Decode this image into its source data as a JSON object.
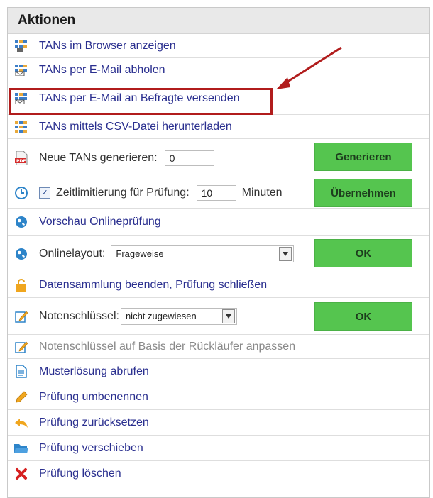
{
  "panel": {
    "title": "Aktionen",
    "items": {
      "tans_browser": "TANs im Browser anzeigen",
      "tans_email_fetch": "TANs per E-Mail abholen",
      "tans_email_send": "TANs per E-Mail an Befragte versenden",
      "tans_csv": "TANs mittels CSV-Datei herunterladen",
      "neue_tans": {
        "label": "Neue TANs generieren:",
        "value": "0",
        "button": "Generieren"
      },
      "zeitlimit": {
        "checked": true,
        "checkmark": "✓",
        "label": "Zeitlimitierung für Prüfung:",
        "value": "10",
        "unit": "Minuten",
        "button": "Übernehmen"
      },
      "vorschau": "Vorschau Onlineprüfung",
      "onlinelayout": {
        "label": "Onlinelayout:",
        "selected": "Frageweise",
        "button": "OK"
      },
      "datensammlung": "Datensammlung beenden, Prüfung schließen",
      "notenschluessel": {
        "label": "Notenschlüssel:",
        "selected": "nicht zugewiesen",
        "button": "OK"
      },
      "notenschluessel_anpassen": "Notenschlüssel auf Basis der Rückläufer anpassen",
      "musterloesung": "Musterlösung abrufen",
      "umbenennen": "Prüfung umbenennen",
      "zuruecksetzen": "Prüfung zurücksetzen",
      "verschieben": "Prüfung verschieben",
      "loeschen": "Prüfung löschen"
    }
  },
  "colors": {
    "link": "#2a2f8f",
    "button_green": "#55c54f",
    "highlight_red": "#b11c1c",
    "header_bg": "#e9e9e9"
  },
  "icons": [
    "tan-list-icon",
    "tan-email-icon",
    "tan-email-icon",
    "tan-csv-icon",
    "pdf-icon",
    "clock-icon",
    "globe-icon",
    "globe-icon",
    "unlock-icon",
    "edit-icon",
    "edit-icon",
    "document-icon",
    "pencil-icon",
    "undo-icon",
    "folder-icon",
    "delete-x-icon"
  ]
}
